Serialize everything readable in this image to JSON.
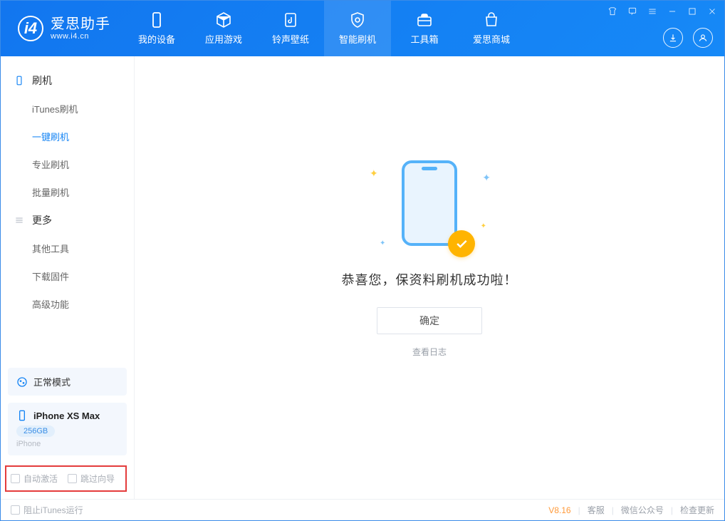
{
  "app": {
    "title": "爱思助手",
    "subtitle": "www.i4.cn"
  },
  "nav": {
    "mydevice": "我的设备",
    "apps": "应用游戏",
    "ringtones": "铃声壁纸",
    "flash": "智能刷机",
    "toolbox": "工具箱",
    "store": "爱思商城"
  },
  "sidebar": {
    "cat_flash": "刷机",
    "items_flash": {
      "itunes": "iTunes刷机",
      "oneclick": "一键刷机",
      "pro": "专业刷机",
      "batch": "批量刷机"
    },
    "cat_more": "更多",
    "items_more": {
      "othertools": "其他工具",
      "firmware": "下载固件",
      "advanced": "高级功能"
    },
    "mode_label": "正常模式",
    "device_name": "iPhone XS Max",
    "device_storage": "256GB",
    "device_type": "iPhone",
    "chk_autoactivate": "自动激活",
    "chk_skipsetup": "跳过向导"
  },
  "main_area": {
    "success_title": "恭喜您，保资料刷机成功啦！",
    "ok": "确定",
    "view_log": "查看日志"
  },
  "footer": {
    "block_itunes": "阻止iTunes运行",
    "version": "V8.16",
    "support": "客服",
    "wechat": "微信公众号",
    "update": "检查更新"
  }
}
